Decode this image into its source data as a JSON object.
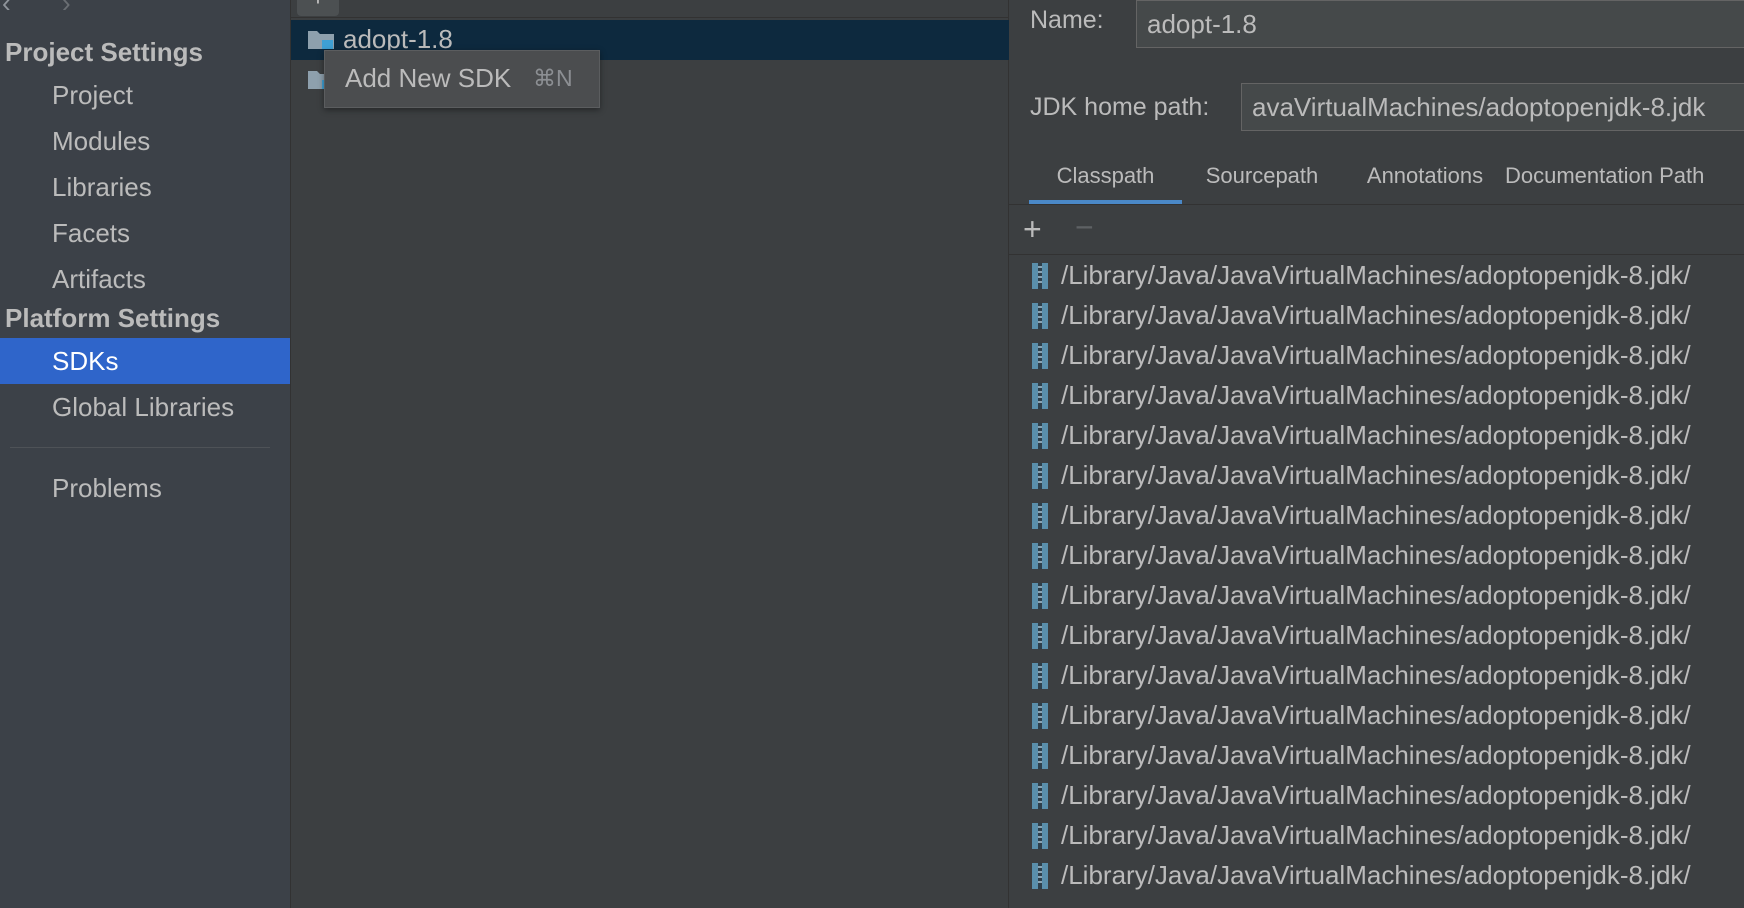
{
  "nav": {
    "sections": [
      {
        "title": "Project Settings",
        "items": [
          "Project",
          "Modules",
          "Libraries",
          "Facets",
          "Artifacts"
        ]
      },
      {
        "title": "Platform Settings",
        "items": [
          "SDKs",
          "Global Libraries"
        ]
      }
    ],
    "selected": "SDKs",
    "problems_label": "Problems"
  },
  "sdk_list": {
    "toolbar_add": "+",
    "items": [
      "adopt-1.8"
    ],
    "selected_index": 0
  },
  "popup": {
    "label": "Add New SDK",
    "shortcut": "⌘N"
  },
  "details": {
    "name_label": "Name:",
    "name_value": "adopt-1.8",
    "home_label": "JDK home path:",
    "home_value": "avaVirtualMachines/adoptopenjdk-8.jdk",
    "tabs": [
      "Classpath",
      "Sourcepath",
      "Annotations",
      "Documentation Path"
    ],
    "active_tab": "Classpath",
    "add_label": "+",
    "remove_label": "−",
    "paths": [
      "/Library/Java/JavaVirtualMachines/adoptopenjdk-8.jdk/",
      "/Library/Java/JavaVirtualMachines/adoptopenjdk-8.jdk/",
      "/Library/Java/JavaVirtualMachines/adoptopenjdk-8.jdk/",
      "/Library/Java/JavaVirtualMachines/adoptopenjdk-8.jdk/",
      "/Library/Java/JavaVirtualMachines/adoptopenjdk-8.jdk/",
      "/Library/Java/JavaVirtualMachines/adoptopenjdk-8.jdk/",
      "/Library/Java/JavaVirtualMachines/adoptopenjdk-8.jdk/",
      "/Library/Java/JavaVirtualMachines/adoptopenjdk-8.jdk/",
      "/Library/Java/JavaVirtualMachines/adoptopenjdk-8.jdk/",
      "/Library/Java/JavaVirtualMachines/adoptopenjdk-8.jdk/",
      "/Library/Java/JavaVirtualMachines/adoptopenjdk-8.jdk/",
      "/Library/Java/JavaVirtualMachines/adoptopenjdk-8.jdk/",
      "/Library/Java/JavaVirtualMachines/adoptopenjdk-8.jdk/",
      "/Library/Java/JavaVirtualMachines/adoptopenjdk-8.jdk/",
      "/Library/Java/JavaVirtualMachines/adoptopenjdk-8.jdk/",
      "/Library/Java/JavaVirtualMachines/adoptopenjdk-8.jdk/"
    ]
  },
  "colors": {
    "selection": "#2f65ca",
    "list_selection": "#0d293e",
    "tab_underline": "#4a88c7"
  }
}
